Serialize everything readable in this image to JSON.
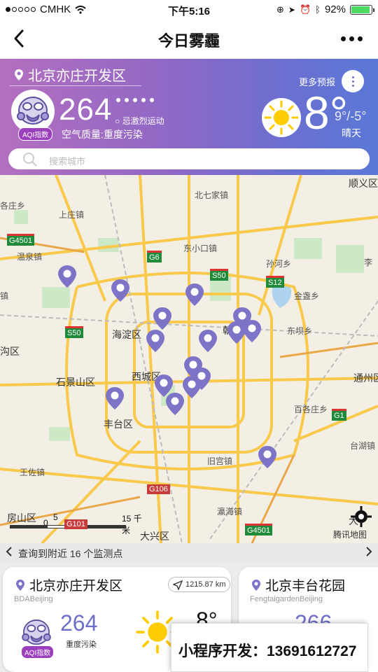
{
  "status_bar": {
    "carrier": "CMHK",
    "time": "下午5:16",
    "battery": "92%",
    "battery_level": 0.92
  },
  "nav": {
    "title": "今日雾霾",
    "back_icon": "chevron-left-icon",
    "more_icon": "ellipsis-icon"
  },
  "header": {
    "location": "北京亦庄开发区",
    "aqi": "264",
    "aqi_tag": "AQI指数",
    "advice": "忌激烈运动",
    "quality": "空气质量:重度污染",
    "more_forecast": "更多预报",
    "temperature": "8°",
    "temp_range": "9°/-5°",
    "weather": "晴天",
    "colors": {
      "gradient_start": "#b46fbf",
      "gradient_end": "#5a78d6",
      "tag": "#9b3fbf"
    }
  },
  "search": {
    "placeholder": "搜索城市"
  },
  "map": {
    "labels": {
      "shunyi": "顺义区",
      "beiqijia": "北七家镇",
      "gezhuang": "各庄乡",
      "shangzhuang": "上庄镇",
      "dongxiaokou": "东小口镇",
      "wenquan": "温泉镇",
      "sunhe": "孙河乡",
      "li": "李",
      "jinzhan": "金盏乡",
      "zhen": "镇",
      "haidian": "海淀区",
      "chaoyang": "朝阳区",
      "dongba": "东坝乡",
      "goukou": "沟区",
      "shijingshan": "石景山区",
      "xicheng": "西城区",
      "tongzhou": "通州区",
      "fengtai": "丰台区",
      "baizhuang": "百各庄乡",
      "taihu": "台湖镇",
      "wangzuo": "王佐镇",
      "jiugong": "旧宫镇",
      "yinghai": "瀛海镇",
      "fangshan": "房山区",
      "daxing": "大兴区",
      "da": "大"
    },
    "roads": {
      "g4501_top": "G4501",
      "g6": "G6",
      "s50_top": "S50",
      "s12": "S12",
      "s50_left": "S50",
      "g1": "G1",
      "g106": "G106",
      "g4501_bottom": "G4501",
      "g101": "G101"
    },
    "scale": {
      "zero": "0",
      "five": "5",
      "fifteen": "15 千米"
    },
    "attribution": "腾讯地图"
  },
  "nearby": {
    "text": "查询到附近 16 个监测点"
  },
  "cards": [
    {
      "name": "北京亦庄开发区",
      "english": "BDABeijing",
      "distance": "1215.87 km",
      "aqi": "264",
      "tag": "AQI指数",
      "quality": "重度污染",
      "temp": "8°"
    },
    {
      "name": "北京丰台花园",
      "english": "FengtaigardenBeijing",
      "aqi": "266"
    }
  ],
  "promo": {
    "text": "小程序开发：13691612727"
  }
}
